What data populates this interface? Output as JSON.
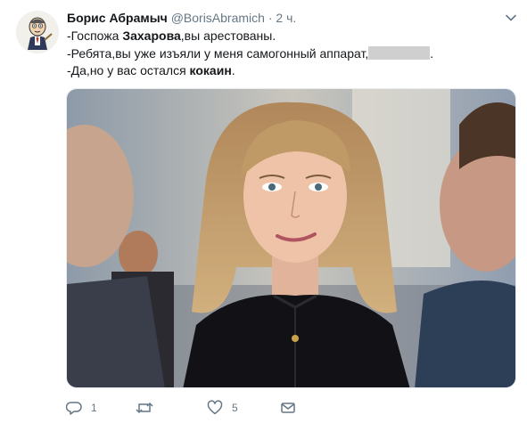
{
  "tweet": {
    "author_name": "Борис Абрамыч",
    "author_handle": "@BorisAbramich",
    "separator": "·",
    "timestamp": "2 ч.",
    "lines": [
      {
        "before": "-Госпожа ",
        "bold": "Захарова",
        "after": ",вы арестованы."
      },
      {
        "before": "-Ребята,вы уже изъяли у меня самогонный аппарат,",
        "bold": "",
        "after": "."
      },
      {
        "before": "-Да,но у вас остался ",
        "bold": "кокаин",
        "after": "."
      }
    ]
  },
  "actions": {
    "reply_count": "1",
    "retweet_count": "",
    "like_count": "5"
  },
  "icons": {
    "avatar": "cartoon-avatar",
    "caret": "chevron-down-icon",
    "reply": "reply-icon",
    "retweet": "retweet-icon",
    "like": "heart-icon",
    "message": "envelope-icon"
  },
  "colors": {
    "text": "#14171a",
    "secondary": "#657786"
  }
}
